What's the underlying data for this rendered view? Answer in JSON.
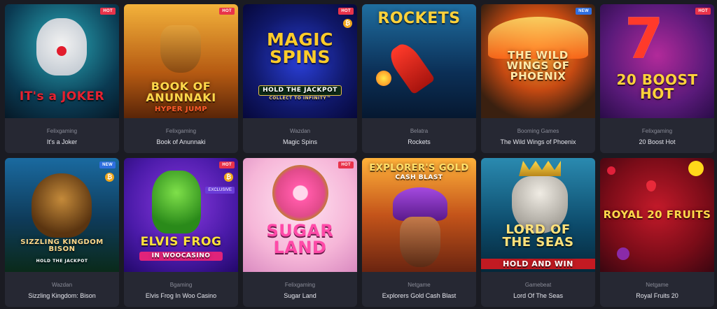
{
  "games": [
    {
      "provider": "Felixgaming",
      "name": "It's a Joker",
      "badge": "HOT",
      "art_title": "IT's a JOKER"
    },
    {
      "provider": "Felixgaming",
      "name": "Book of Anunnaki",
      "badge": "HOT",
      "art_title": "BOOK OF ANUNNAKI",
      "art_sub": "HYPER JUMP"
    },
    {
      "provider": "Wazdan",
      "name": "Magic Spins",
      "badge": "HOT",
      "coin": "₿",
      "art_title": "MAGIC SPINS",
      "art_sub": "HOLD THE JACKPOT",
      "art_sub2": "COLLECT TO INFINITY™"
    },
    {
      "provider": "Belatra",
      "name": "Rockets",
      "art_title": "ROCKETS"
    },
    {
      "provider": "Booming Games",
      "name": "The Wild Wings of Phoenix",
      "badge": "NEW",
      "art_title": "THE WILD WINGS OF PHOENIX"
    },
    {
      "provider": "Felixgaming",
      "name": "20 Boost Hot",
      "badge": "HOT",
      "art_title": "20 BOOST HOT"
    },
    {
      "provider": "Wazdan",
      "name": "Sizzling Kingdom: Bison",
      "badge": "NEW",
      "coin": "₿",
      "art_title": "SIZZLING KINGDOM BISON",
      "art_sub": "HOLD THE JACKPOT"
    },
    {
      "provider": "Bgaming",
      "name": "Elvis Frog In Woo Casino",
      "badge": "HOT",
      "coin": "₿",
      "exclusive": "EXCLUSIVE",
      "art_title": "ELVIS FROG",
      "art_sub": "IN WOOCASINO"
    },
    {
      "provider": "Felixgaming",
      "name": "Sugar Land",
      "badge": "HOT",
      "art_title": "SUGAR LAND"
    },
    {
      "provider": "Netgame",
      "name": "Explorers Gold Cash Blast",
      "art_title": "EXPLORER'S GOLD",
      "art_sub": "CASH BLAST"
    },
    {
      "provider": "Gamebeat",
      "name": "Lord Of The Seas",
      "art_title": "LORD OF THE SEAS",
      "art_sub": "HOLD AND WIN"
    },
    {
      "provider": "Netgame",
      "name": "Royal Fruits 20",
      "art_title": "ROYAL 20 FRUITS"
    }
  ],
  "colors": {
    "hot": "#e8334a",
    "new": "#2f6fe0",
    "card_bg": "#262833",
    "page_bg": "#1a1b22"
  }
}
